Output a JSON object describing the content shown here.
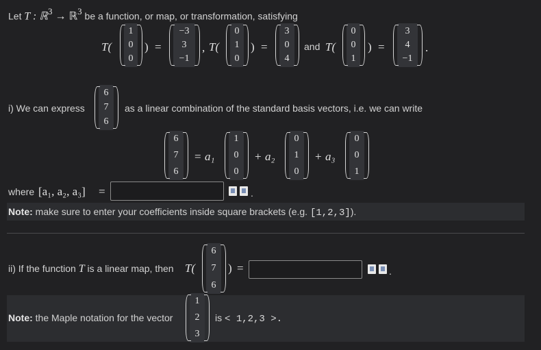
{
  "intro": {
    "let": "Let ",
    "map": "T : ℝ",
    "exp1": "3",
    "arrow": " → ℝ",
    "exp2": "3",
    "rest": " be a function, or map, or transformation, satisfying"
  },
  "defs": {
    "T1_in": [
      "1",
      "0",
      "0"
    ],
    "T1_out": [
      "−3",
      "3",
      "−1"
    ],
    "T2_in": [
      "0",
      "1",
      "0"
    ],
    "T2_out": [
      "3",
      "0",
      "4"
    ],
    "T3_in": [
      "0",
      "0",
      "1"
    ],
    "T3_out": [
      "3",
      "4",
      "−1"
    ],
    "T_label": "T(",
    "eq": "=",
    "comma": ",",
    "and": "and",
    "period": "."
  },
  "part1": {
    "label": "i) We can express",
    "vector": [
      "6",
      "7",
      "6"
    ],
    "desc": "as a linear combination of the standard basis vectors, i.e. we can write",
    "eq_lhs": [
      "6",
      "7",
      "6"
    ],
    "a1": "a₁",
    "a2": "a₂",
    "a3": "a₃",
    "plus": "+",
    "e1": [
      "1",
      "0",
      "0"
    ],
    "e2": [
      "0",
      "1",
      "0"
    ],
    "e3": [
      "0",
      "0",
      "1"
    ],
    "where": "where ",
    "coeffs": "[a₁, a₂, a₃]",
    "input_value": "",
    "note_bold": "Note:",
    "note_text": " make sure to enter your coefficients inside square brackets (e.g. ",
    "note_code": "[1,2,3]",
    "note_end": ")."
  },
  "part2": {
    "label_a": "ii) If the function ",
    "T": "T",
    "label_b": " is a linear map, then ",
    "vector": [
      "6",
      "7",
      "6"
    ],
    "input_value": "",
    "note_bold": "Note:",
    "note_text": " the Maple notation for the vector",
    "note_vec": [
      "1",
      "2",
      "3"
    ],
    "note_is": "is",
    "note_code": "< 1,2,3 >."
  }
}
